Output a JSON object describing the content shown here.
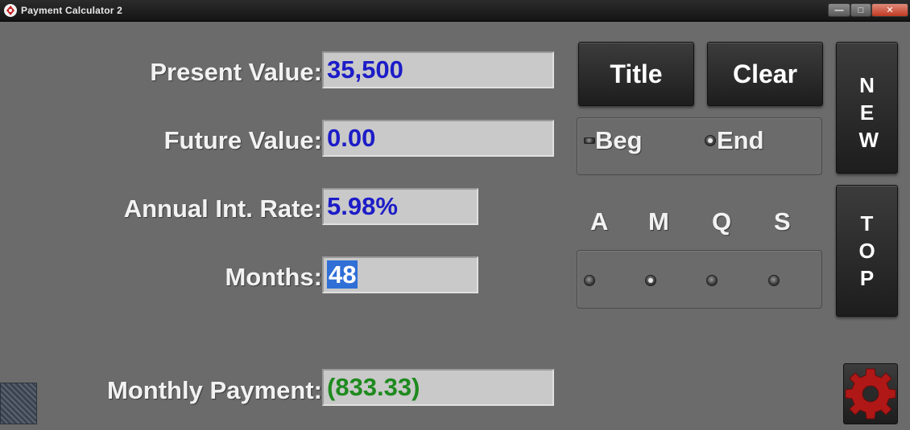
{
  "window": {
    "title": "Payment Calculator 2",
    "controls": {
      "minimize": "—",
      "maximize": "□",
      "close": "✕"
    }
  },
  "fields": {
    "present_value": {
      "label": "Present Value:",
      "value": "35,500"
    },
    "future_value": {
      "label": "Future Value:",
      "value": "0.00"
    },
    "annual_rate": {
      "label": "Annual Int. Rate:",
      "value": "5.98%"
    },
    "months": {
      "label": "Months:",
      "value": "48"
    },
    "monthly_payment": {
      "label": "Monthly Payment:",
      "value": "(833.33)"
    }
  },
  "buttons": {
    "title": "Title",
    "clear": "Clear",
    "new": "NEW",
    "top": "TOP"
  },
  "timing": {
    "beg": "Beg",
    "end": "End",
    "selected": "End"
  },
  "compounding": {
    "options": [
      "A",
      "M",
      "Q",
      "S"
    ],
    "selected": "M"
  },
  "icons": {
    "app": "app-icon",
    "settings": "gear-icon"
  },
  "colors": {
    "input_text": "#1c1cc8",
    "result_text": "#1f8a1f",
    "selection": "#2f6fd6",
    "gear": "#b01818"
  }
}
